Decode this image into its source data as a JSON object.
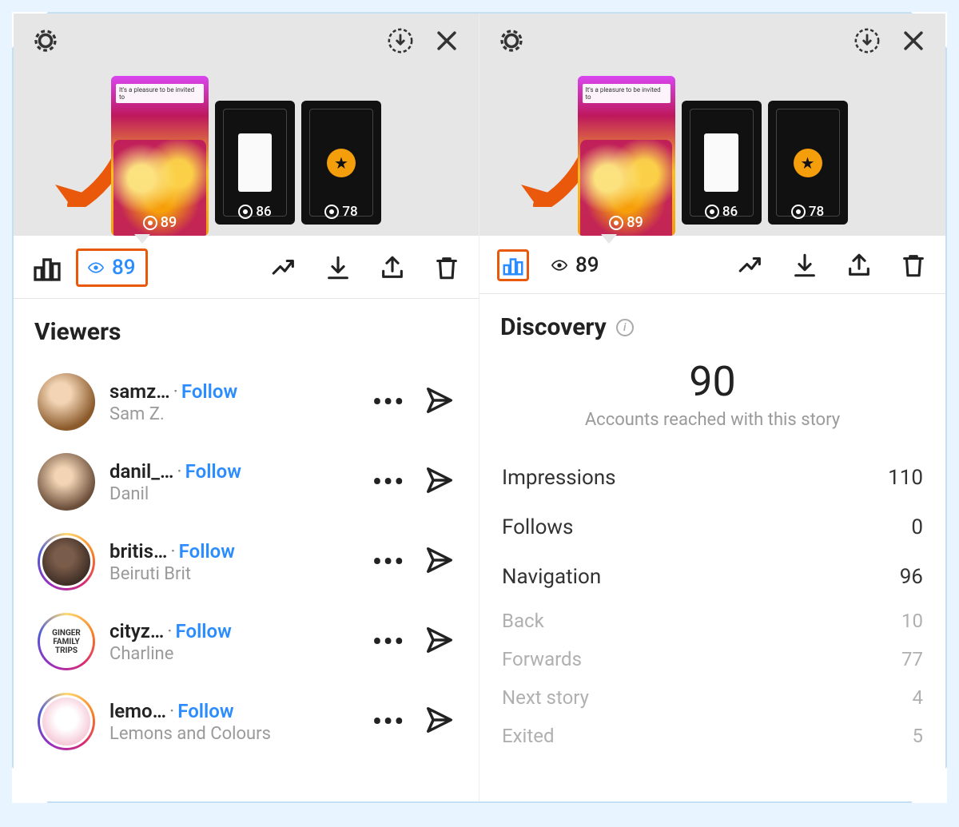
{
  "colors": {
    "highlight": "#e8590c",
    "accent_blue": "#2b8cff"
  },
  "stories": {
    "thumbs": [
      {
        "views": "89",
        "caption": "It's a pleasure to be invited to"
      },
      {
        "views": "86"
      },
      {
        "views": "78"
      }
    ]
  },
  "toolbar": {
    "views_count": "89"
  },
  "left": {
    "section_title": "Viewers",
    "viewers": [
      {
        "handle": "samz…",
        "name": "Sam Z.",
        "follow": "Follow"
      },
      {
        "handle": "danil_…",
        "name": "Danil",
        "follow": "Follow"
      },
      {
        "handle": "britis…",
        "name": "Beiruti Brit",
        "follow": "Follow"
      },
      {
        "handle": "cityz…",
        "name": "Charline",
        "follow": "Follow",
        "avatar_text": "GINGER\nFAMILY\nTRIPS"
      },
      {
        "handle": "lemo…",
        "name": "Lemons and Colours",
        "follow": "Follow"
      }
    ]
  },
  "right": {
    "section_title": "Discovery",
    "reached_number": "90",
    "reached_caption": "Accounts reached with this story",
    "stats": {
      "impressions_label": "Impressions",
      "impressions_value": "110",
      "follows_label": "Follows",
      "follows_value": "0",
      "navigation_label": "Navigation",
      "navigation_value": "96",
      "back_label": "Back",
      "back_value": "10",
      "forwards_label": "Forwards",
      "forwards_value": "77",
      "nextstory_label": "Next story",
      "nextstory_value": "4",
      "exited_label": "Exited",
      "exited_value": "5"
    }
  }
}
